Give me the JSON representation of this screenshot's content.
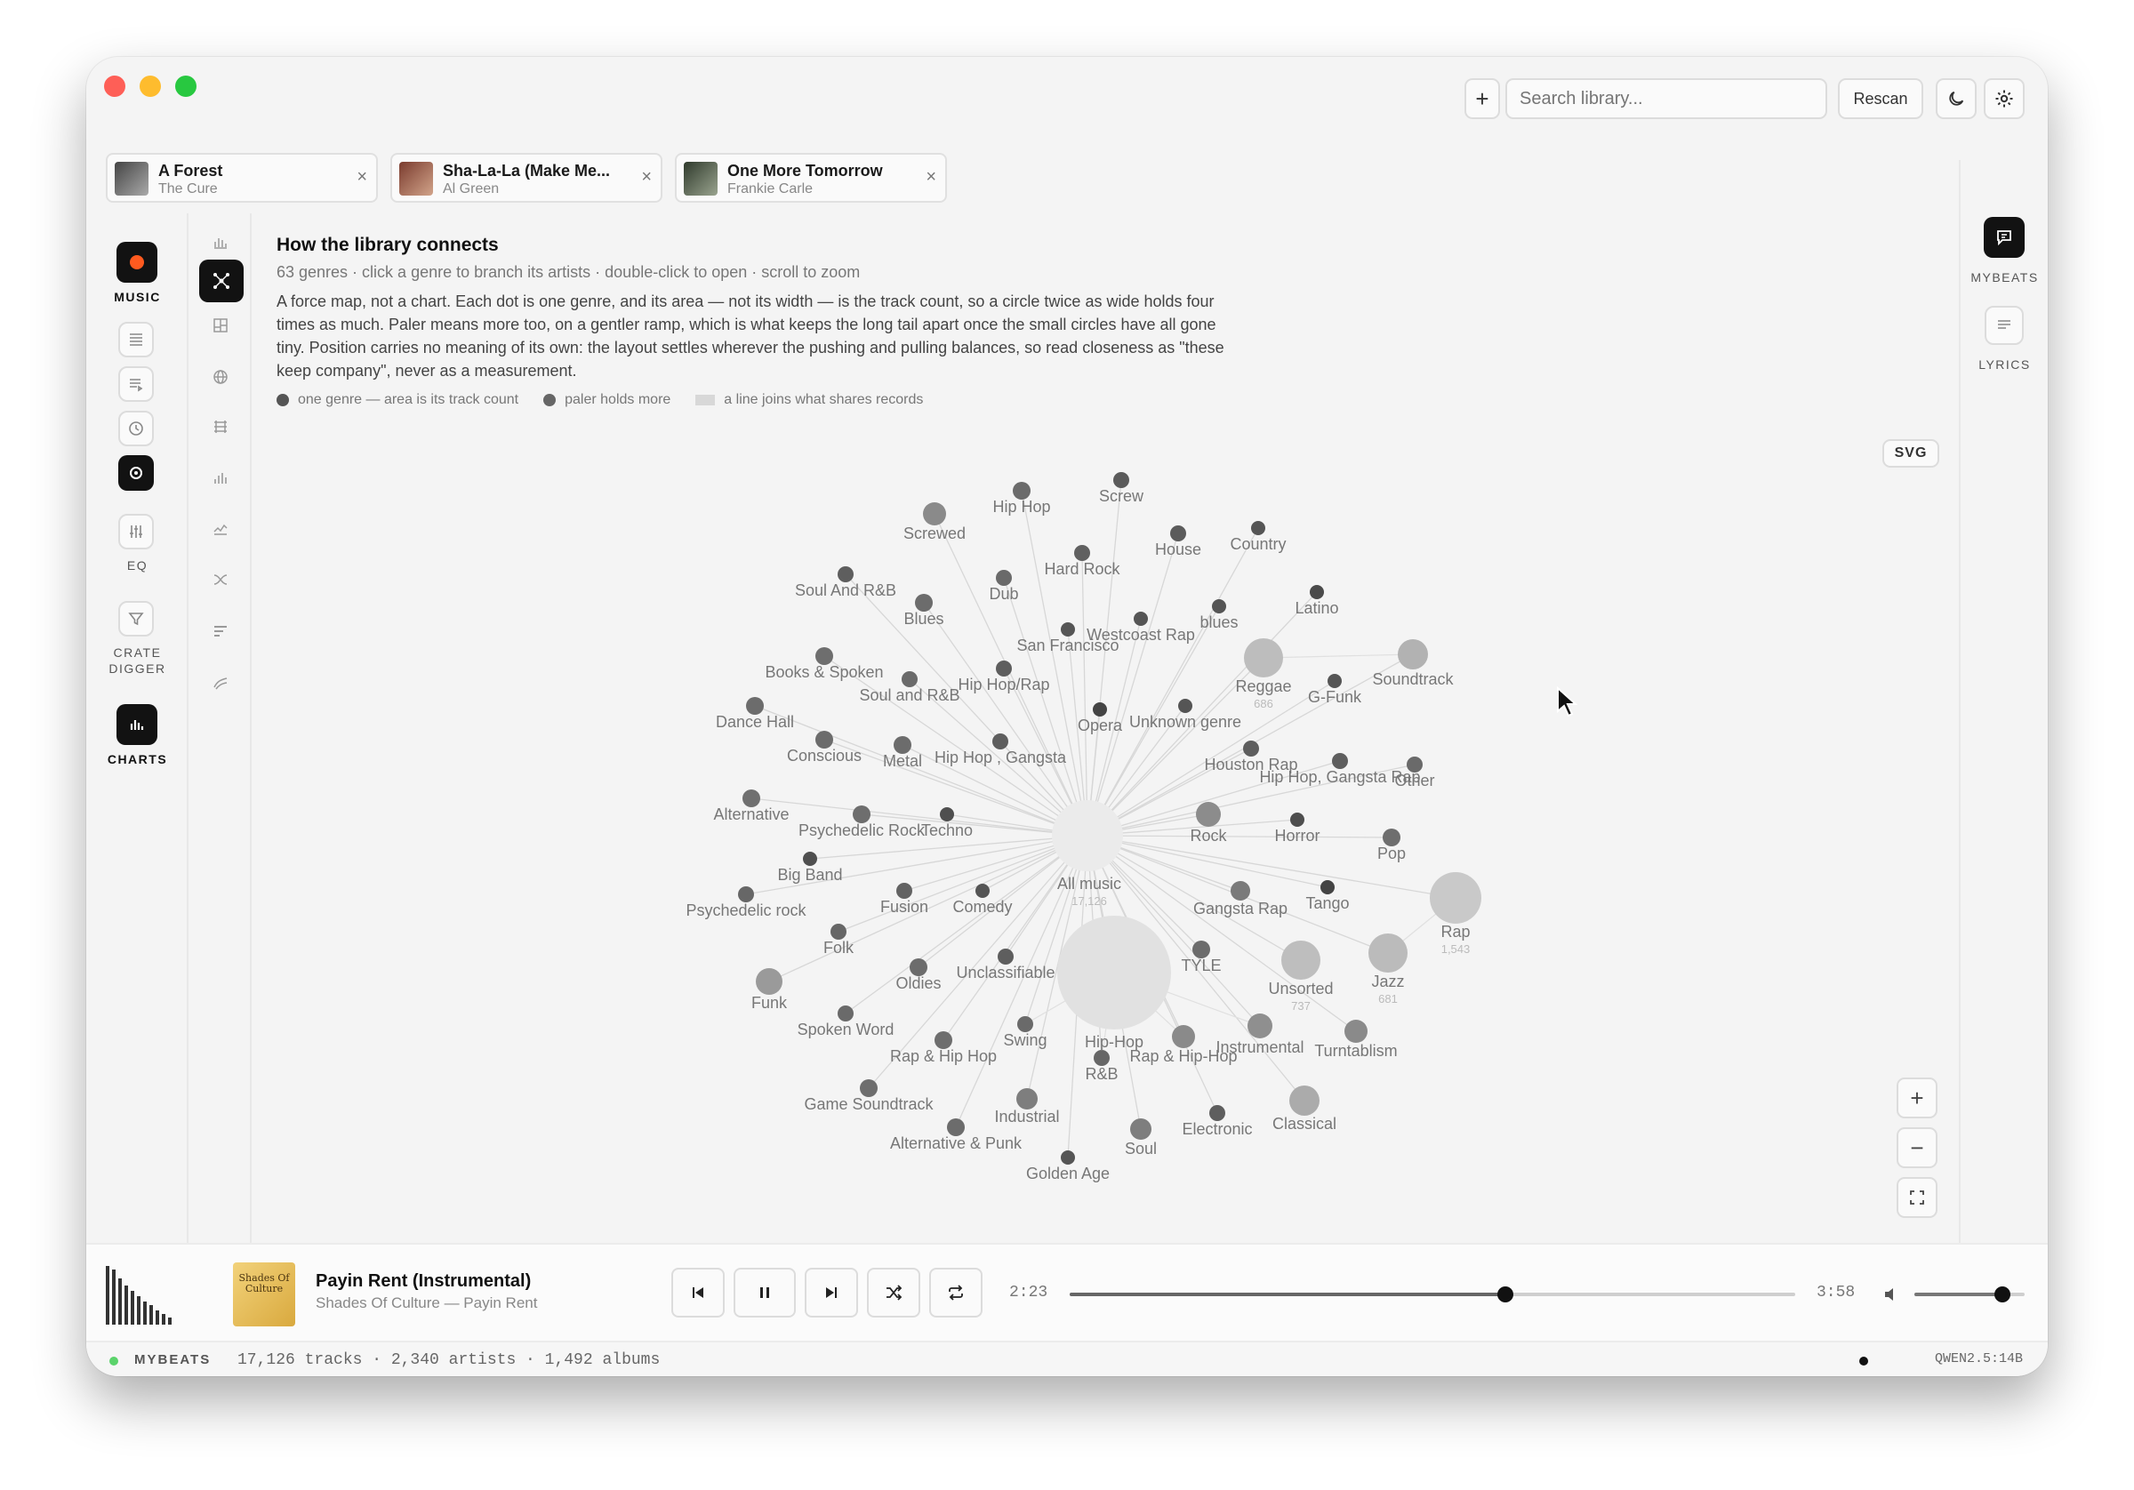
{
  "toolbar": {
    "search_placeholder": "Search library...",
    "rescan_label": "Rescan",
    "add_label": "+"
  },
  "tabs": [
    {
      "title": "A Forest",
      "artist": "The Cure",
      "close": "×"
    },
    {
      "title": "Sha-La-La (Make Me...",
      "artist": "Al Green",
      "close": "×"
    },
    {
      "title": "One More Tomorrow",
      "artist": "Frankie Carle",
      "close": "×"
    }
  ],
  "rail": {
    "music": "MUSIC",
    "eq": "EQ",
    "crate_digger_1": "CRATE",
    "crate_digger_2": "DIGGER",
    "charts": "CHARTS"
  },
  "right_rail": {
    "mybeats": "MYBEATS",
    "lyrics": "LYRICS"
  },
  "main": {
    "title": "How the library connects",
    "subtitle": "63 genres · click a genre to branch its artists · double-click to open · scroll to zoom",
    "description": "A force map, not a chart. Each dot is one genre, and its area — not its width — is the track count, so a circle twice as wide holds four times as much. Paler means more too, on a gentler ramp, which is what keeps the long tail apart once the small circles have all gone tiny. Position carries no meaning of its own: the layout settles wherever the pushing and pulling balances, so read closeness as \"these keep company\", never as a measurement.",
    "legend": [
      "one genre — area is its track count",
      "paler holds more",
      "a line joins what shares records"
    ],
    "svg_label": "SVG",
    "zoom_in": "+",
    "zoom_out": "−"
  },
  "chart_data": {
    "type": "network",
    "center": {
      "name": "All music",
      "count": "17,126"
    },
    "nodes": [
      {
        "name": "Hip Hop"
      },
      {
        "name": "Screw"
      },
      {
        "name": "Screwed"
      },
      {
        "name": "House"
      },
      {
        "name": "Country"
      },
      {
        "name": "Hard Rock"
      },
      {
        "name": "Soul And R&B"
      },
      {
        "name": "Dub"
      },
      {
        "name": "Blues"
      },
      {
        "name": "Latino"
      },
      {
        "name": "blues"
      },
      {
        "name": "Westcoast Rap"
      },
      {
        "name": "San Francisco"
      },
      {
        "name": "Reggae",
        "count": "686"
      },
      {
        "name": "Soundtrack"
      },
      {
        "name": "Books & Spoken"
      },
      {
        "name": "G-Funk"
      },
      {
        "name": "Hip Hop/Rap"
      },
      {
        "name": "Soul and R&B"
      },
      {
        "name": "Dance Hall"
      },
      {
        "name": "Opera"
      },
      {
        "name": "Unknown genre"
      },
      {
        "name": "Conscious"
      },
      {
        "name": "Metal"
      },
      {
        "name": "Hip Hop , Gangsta"
      },
      {
        "name": "Houston Rap"
      },
      {
        "name": "Hip Hop, Gangsta Rap"
      },
      {
        "name": "Other"
      },
      {
        "name": "Alternative"
      },
      {
        "name": "Psychedelic Rock"
      },
      {
        "name": "Techno"
      },
      {
        "name": "Rock"
      },
      {
        "name": "Horror"
      },
      {
        "name": "Pop"
      },
      {
        "name": "Big Band"
      },
      {
        "name": "Psychedelic rock"
      },
      {
        "name": "Fusion"
      },
      {
        "name": "Comedy"
      },
      {
        "name": "Gangsta Rap"
      },
      {
        "name": "Tango"
      },
      {
        "name": "Rap",
        "count": "1,543"
      },
      {
        "name": "Folk"
      },
      {
        "name": "Unclassifiable"
      },
      {
        "name": "Oldies"
      },
      {
        "name": "TYLE"
      },
      {
        "name": "Unsorted",
        "count": "737"
      },
      {
        "name": "Jazz",
        "count": "681"
      },
      {
        "name": "Funk"
      },
      {
        "name": "Spoken Word"
      },
      {
        "name": "Hip-Hop"
      },
      {
        "name": "Swing"
      },
      {
        "name": "Rap & Hip Hop"
      },
      {
        "name": "Rap & Hip-Hop"
      },
      {
        "name": "Instrumental"
      },
      {
        "name": "Turntablism"
      },
      {
        "name": "R&B"
      },
      {
        "name": "Game Soundtrack"
      },
      {
        "name": "Industrial"
      },
      {
        "name": "Classical"
      },
      {
        "name": "Electronic"
      },
      {
        "name": "Alternative & Punk"
      },
      {
        "name": "Soul"
      },
      {
        "name": "Golden Age"
      }
    ]
  },
  "player": {
    "song": "Payin Rent (Instrumental)",
    "artist_album": "Shades Of Culture — Payin Rent",
    "cover_text": "Shades Of Culture",
    "elapsed": "2:23",
    "duration": "3:58",
    "progress": 0.6,
    "volume": 0.8
  },
  "status": {
    "brand": "MYBEATS",
    "stats": "17,126 tracks · 2,340 artists · 1,492 albums",
    "model": "QWEN2.5:14B"
  }
}
